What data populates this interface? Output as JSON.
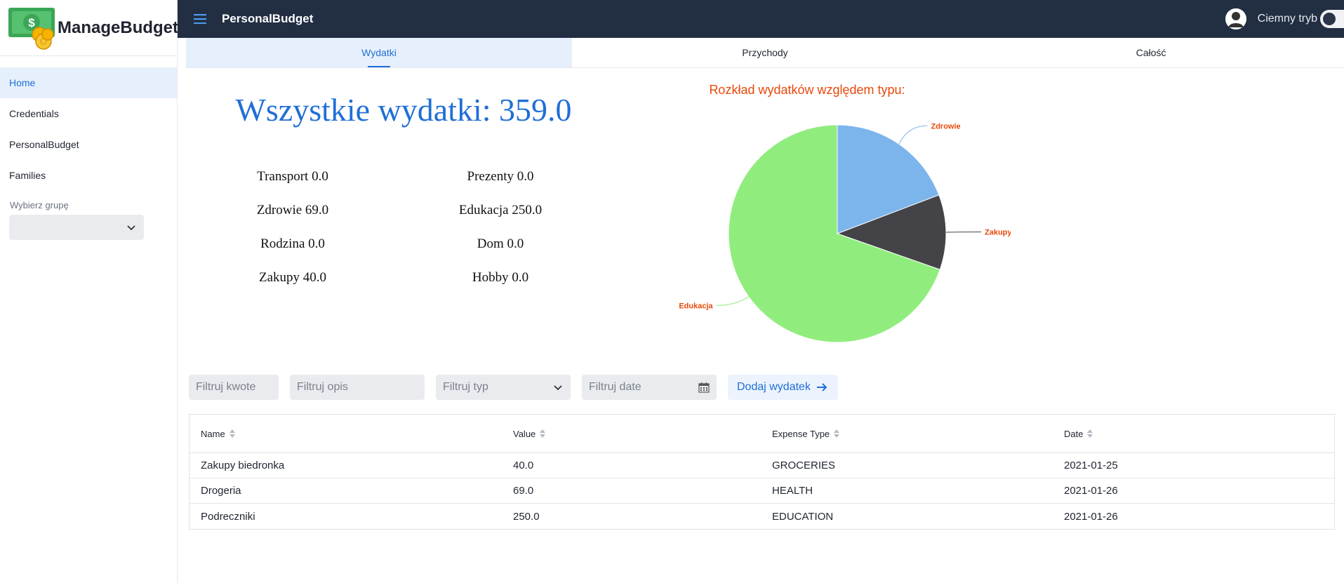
{
  "brand": {
    "name": "ManageBudget",
    "logo_icon": "money-bill-coins-icon"
  },
  "sidebar": {
    "items": [
      {
        "label": "Home",
        "active": true
      },
      {
        "label": "Credentials",
        "active": false
      },
      {
        "label": "PersonalBudget",
        "active": false
      },
      {
        "label": "Families",
        "active": false
      }
    ],
    "group_label": "Wybierz grupę",
    "group_value": ""
  },
  "header": {
    "title": "PersonalBudget",
    "dark_mode_label": "Ciemny tryb",
    "dark_mode_on": false,
    "bg_color": "#222e42"
  },
  "tabs": [
    {
      "label": "Wydatki",
      "active": true
    },
    {
      "label": "Przychody",
      "active": false
    },
    {
      "label": "Całość",
      "active": false
    }
  ],
  "summary": {
    "total": "Wszystkie wydatki: 359.0",
    "left": [
      "Transport 0.0",
      "Zdrowie 69.0",
      "Rodzina 0.0",
      "Zakupy 40.0"
    ],
    "right": [
      "Prezenty 0.0",
      "Edukacja 250.0",
      "Dom 0.0",
      "Hobby 0.0"
    ]
  },
  "chart_data": {
    "type": "pie",
    "title": "Rozkład wydatków względem typu:",
    "slices": [
      {
        "label": "Zdrowie",
        "value": 69.0,
        "color": "#7cb5ec"
      },
      {
        "label": "Zakupy",
        "value": 40.0,
        "color": "#434348"
      },
      {
        "label": "Edukacja",
        "value": 250.0,
        "color": "#90ed7d"
      }
    ],
    "label_color": "#e8480a"
  },
  "filters": {
    "amount_placeholder": "Filtruj kwote",
    "description_placeholder": "Filtruj opis",
    "type_placeholder": "Filtruj typ",
    "date_placeholder": "Filtruj date",
    "add_label": "Dodaj wydatek"
  },
  "table": {
    "columns": [
      "Name",
      "Value",
      "Expense Type",
      "Date"
    ],
    "rows": [
      [
        "Zakupy biedronka",
        "40.0",
        "GROCERIES",
        "2021-01-25"
      ],
      [
        "Drogeria",
        "69.0",
        "HEALTH",
        "2021-01-26"
      ],
      [
        "Podreczniki",
        "250.0",
        "EDUCATION",
        "2021-01-26"
      ]
    ]
  }
}
